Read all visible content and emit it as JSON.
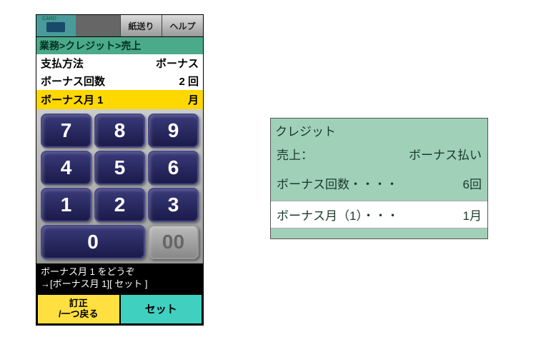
{
  "terminal": {
    "topbar": {
      "paper_feed": "紙送り",
      "help": "ヘルプ"
    },
    "breadcrumb": "業務>クレジット>売上",
    "rows": {
      "pay_method_label": "支払方法",
      "pay_method_value": "ボーナス",
      "bonus_count_label": "ボーナス回数",
      "bonus_count_value": "2 回",
      "bonus_month_label": "ボーナス月 1",
      "bonus_month_unit": "月"
    },
    "keypad": {
      "k7": "7",
      "k8": "8",
      "k9": "9",
      "k4": "4",
      "k5": "5",
      "k6": "6",
      "k1": "1",
      "k2": "2",
      "k3": "3",
      "k0": "0",
      "k00": "00"
    },
    "prompt": {
      "line1": "ボーナス月 1 をどうぞ",
      "line2": "→[ボーナス月 1][ セット ]"
    },
    "buttons": {
      "correct": "訂正\n/一つ戻る",
      "set": "セット"
    }
  },
  "receipt": {
    "header": "クレジット",
    "sale_label": "売上：",
    "sale_value": "ボーナス払い",
    "bonus_count_label": "ボーナス回数・・・・",
    "bonus_count_value": "6回",
    "bonus_month_label": "ボーナス月（1）・・・",
    "bonus_month_value": "1月"
  }
}
